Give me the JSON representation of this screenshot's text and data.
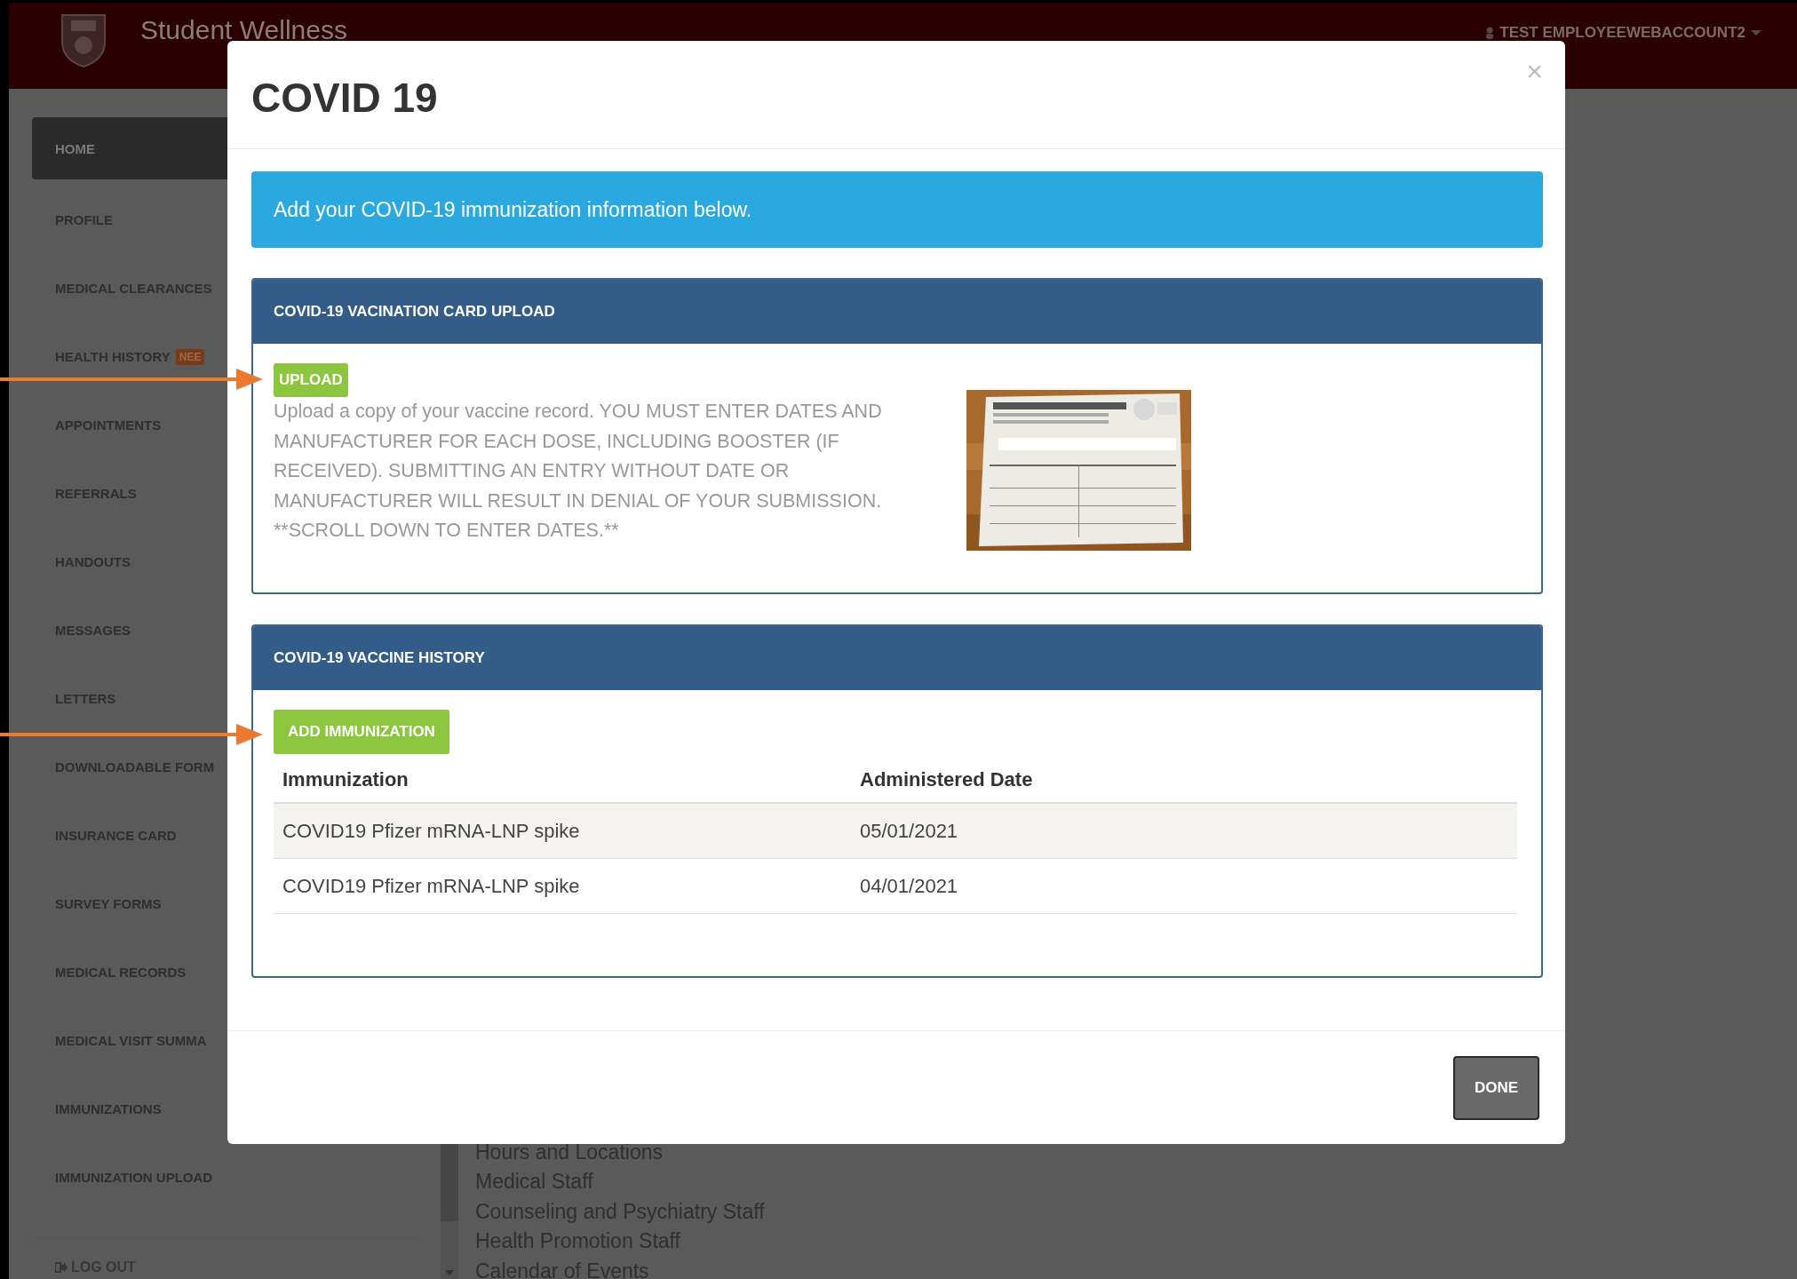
{
  "header": {
    "brand": "Student Wellness",
    "user": "TEST EMPLOYEEWEBACCOUNT2"
  },
  "sidebar": {
    "items": [
      {
        "label": "HOME",
        "selected": true
      },
      {
        "label": "PROFILE",
        "selected": false
      },
      {
        "label": "MEDICAL CLEARANCES",
        "selected": false
      },
      {
        "label": "HEALTH HISTORY",
        "selected": false,
        "badge": "NEE"
      },
      {
        "label": "APPOINTMENTS",
        "selected": false
      },
      {
        "label": "REFERRALS",
        "selected": false
      },
      {
        "label": "HANDOUTS",
        "selected": false
      },
      {
        "label": "MESSAGES",
        "selected": false
      },
      {
        "label": "LETTERS",
        "selected": false
      },
      {
        "label": "DOWNLOADABLE FORM",
        "selected": false
      },
      {
        "label": "INSURANCE CARD",
        "selected": false
      },
      {
        "label": "SURVEY FORMS",
        "selected": false
      },
      {
        "label": "MEDICAL RECORDS",
        "selected": false
      },
      {
        "label": "MEDICAL VISIT SUMMA",
        "selected": false
      },
      {
        "label": "IMMUNIZATIONS",
        "selected": false
      },
      {
        "label": "IMMUNIZATION UPLOAD",
        "selected": false
      }
    ],
    "logout": "LOG OUT"
  },
  "content": {
    "links": [
      "Hours and Locations",
      "Medical Staff",
      "Counseling and Psychiatry Staff",
      "Health Promotion Staff",
      "Calendar of Events"
    ]
  },
  "modal": {
    "title": "COVID 19",
    "close": "×",
    "alert": "Add your COVID-19 immunization information below.",
    "panels": [
      {
        "kind": "upload",
        "title": "COVID-19 VACINATION CARD UPLOAD",
        "button": "UPLOAD",
        "text": "Upload a copy of your vaccine record. YOU MUST ENTER DATES AND MANUFACTURER FOR EACH DOSE, INCLUDING BOOSTER (IF RECEIVED). SUBMITTING AN ENTRY WITHOUT DATE OR MANUFACTURER WILL RESULT IN DENIAL OF YOUR SUBMISSION. **SCROLL DOWN TO ENTER DATES.**"
      },
      {
        "kind": "history",
        "title": "COVID-19 VACCINE HISTORY",
        "button": "ADD IMMUNIZATION",
        "columns": [
          "Immunization",
          "Administered Date"
        ],
        "rows": [
          [
            "COVID19 Pfizer mRNA-LNP spike",
            "05/01/2021"
          ],
          [
            "COVID19 Pfizer mRNA-LNP spike",
            "04/01/2021"
          ]
        ]
      }
    ],
    "done": "DONE"
  }
}
